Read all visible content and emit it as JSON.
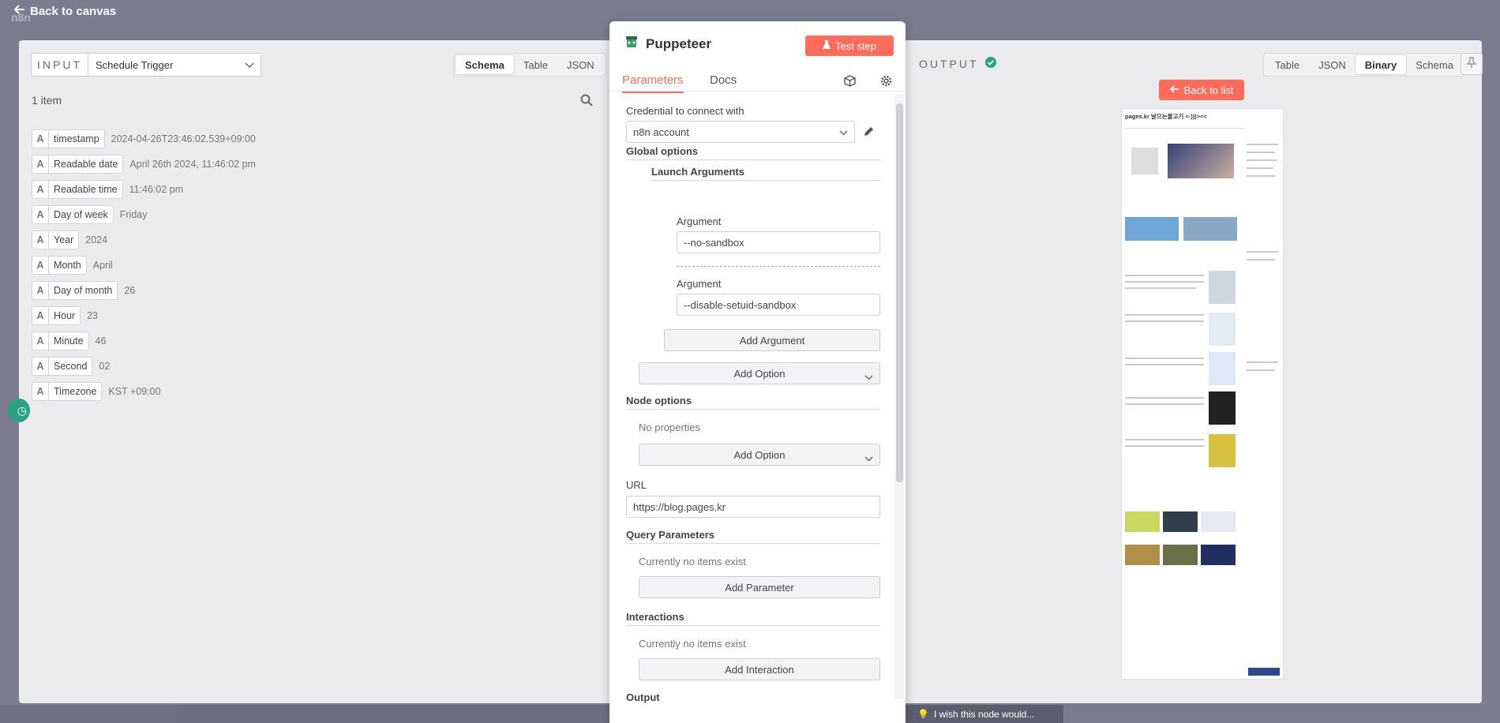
{
  "top": {
    "back_label": "Back to canvas",
    "brand": "n8n"
  },
  "input": {
    "label": "INPUT",
    "source": "Schedule Trigger",
    "views": [
      "Schema",
      "Table",
      "JSON"
    ],
    "active_view": "Schema",
    "item_count": "1 item",
    "fields": [
      {
        "type": "A",
        "name": "timestamp",
        "value": "2024-04-26T23:46:02.539+09:00"
      },
      {
        "type": "A",
        "name": "Readable date",
        "value": "April 26th 2024, 11:46:02 pm"
      },
      {
        "type": "A",
        "name": "Readable time",
        "value": "11:46:02 pm"
      },
      {
        "type": "A",
        "name": "Day of week",
        "value": "Friday"
      },
      {
        "type": "A",
        "name": "Year",
        "value": "2024"
      },
      {
        "type": "A",
        "name": "Month",
        "value": "April"
      },
      {
        "type": "A",
        "name": "Day of month",
        "value": "26"
      },
      {
        "type": "A",
        "name": "Hour",
        "value": "23"
      },
      {
        "type": "A",
        "name": "Minute",
        "value": "46"
      },
      {
        "type": "A",
        "name": "Second",
        "value": "02"
      },
      {
        "type": "A",
        "name": "Timezone",
        "value": "KST +09:00"
      }
    ]
  },
  "node": {
    "title": "Puppeteer",
    "test_label": "Test step",
    "tabs": {
      "parameters": "Parameters",
      "docs": "Docs"
    },
    "credential_label": "Credential to connect with",
    "credential_value": "n8n account",
    "global_options": "Global options",
    "launch_arguments": "Launch Arguments",
    "argument_label": "Argument",
    "argument_1": "--no-sandbox",
    "argument_2": "--disable-setuid-sandbox",
    "add_argument": "Add Argument",
    "add_option": "Add Option",
    "node_options": "Node options",
    "no_properties": "No properties",
    "url_label": "URL",
    "url_value": "https://blog.pages.kr",
    "query_parameters": "Query Parameters",
    "no_items": "Currently no items exist",
    "add_parameter": "Add Parameter",
    "interactions": "Interactions",
    "add_interaction": "Add Interaction",
    "output_label": "Output"
  },
  "output": {
    "label": "OUTPUT",
    "views": [
      "Table",
      "JSON",
      "Binary",
      "Schema"
    ],
    "active_view": "Binary",
    "back_list": "Back to list",
    "preview_title": "pages.kr 날으는물고기 <·)))><<"
  },
  "footer": {
    "wish": "I wish this node would..."
  },
  "colors": {
    "accent": "#ff6d5a",
    "success": "#29a383",
    "backdrop": "#7b7d8f"
  }
}
